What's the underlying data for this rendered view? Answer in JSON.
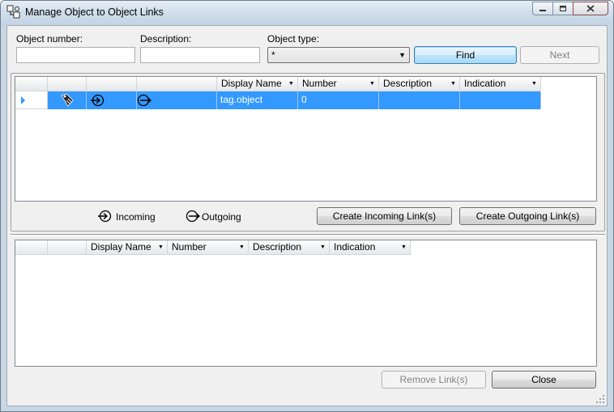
{
  "window": {
    "title": "Manage Object to Object Links"
  },
  "search": {
    "object_number_label": "Object number:",
    "object_number_value": "",
    "description_label": "Description:",
    "description_value": "",
    "object_type_label": "Object type:",
    "object_type_value": "*",
    "find_label": "Find",
    "next_label": "Next"
  },
  "objects_grid": {
    "columns": [
      "Display Name",
      "Number",
      "Description",
      "Indication"
    ],
    "rows": [
      {
        "display_name": "tag.object",
        "number": "0",
        "description": "",
        "indication": ""
      }
    ]
  },
  "legend": {
    "incoming_label": "Incoming",
    "outgoing_label": "Outgoing"
  },
  "actions": {
    "create_incoming_label": "Create Incoming Link(s)",
    "create_outgoing_label": "Create Outgoing Link(s)"
  },
  "links_grid": {
    "columns": [
      "Display Name",
      "Number",
      "Description",
      "Indication"
    ],
    "rows": []
  },
  "footer": {
    "remove_label": "Remove Link(s)",
    "close_label": "Close"
  },
  "colors": {
    "selection": "#3399ff",
    "default_button_border": "#3c7fb1"
  }
}
